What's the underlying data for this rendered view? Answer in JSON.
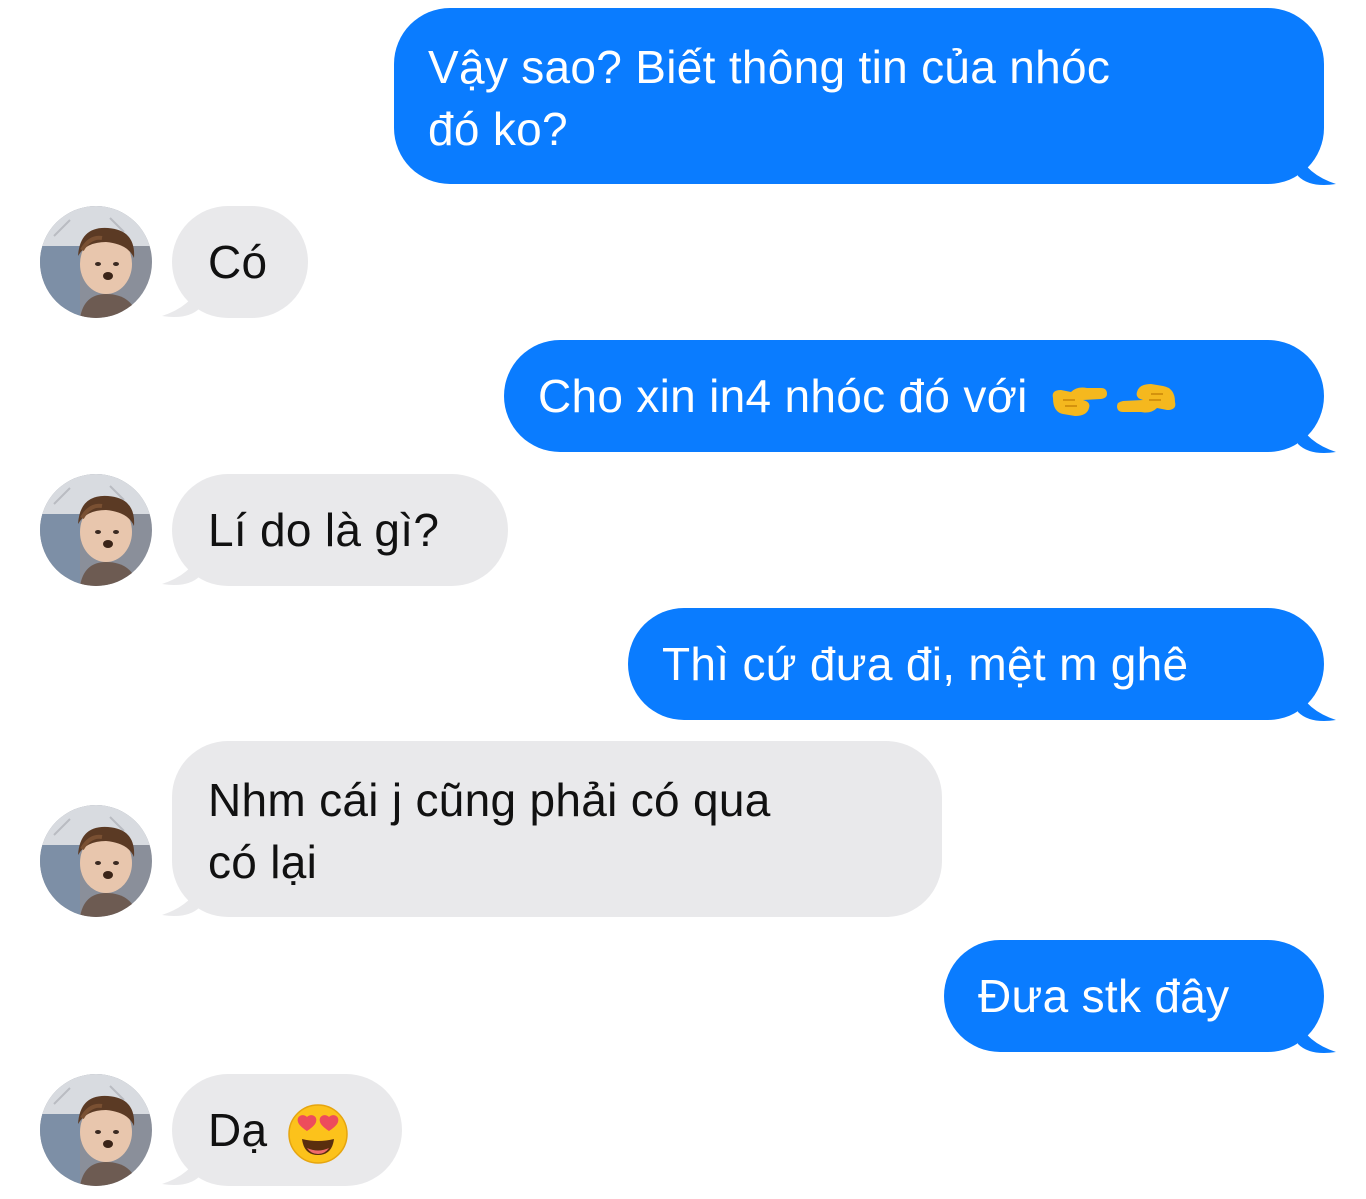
{
  "conversation": {
    "messages": [
      {
        "direction": "outgoing",
        "lines": [
          "Vậy sao? Biết thông tin của nhóc",
          "đó ko?"
        ]
      },
      {
        "direction": "incoming",
        "lines": [
          "Có"
        ]
      },
      {
        "direction": "outgoing",
        "lines": [
          "Cho xin in4 nhóc đó với"
        ],
        "emoji": "backhand-index-pointing-icons"
      },
      {
        "direction": "incoming",
        "lines": [
          "Lí do là gì?"
        ]
      },
      {
        "direction": "outgoing",
        "lines": [
          "Thì cứ đưa đi, mệt m ghê"
        ]
      },
      {
        "direction": "incoming",
        "lines": [
          "Nhm cái j cũng phải có qua",
          "có lại"
        ]
      },
      {
        "direction": "outgoing",
        "lines": [
          "Đưa stk đây"
        ]
      },
      {
        "direction": "incoming",
        "lines": [
          "Dạ"
        ],
        "emoji": "heart-eyes-emoji-icon"
      }
    ]
  },
  "colors": {
    "outgoing_bubble": "#0a7cff",
    "outgoing_text": "#ffffff",
    "incoming_bubble": "#e9e9eb",
    "incoming_text": "#111111",
    "background": "#ffffff"
  }
}
